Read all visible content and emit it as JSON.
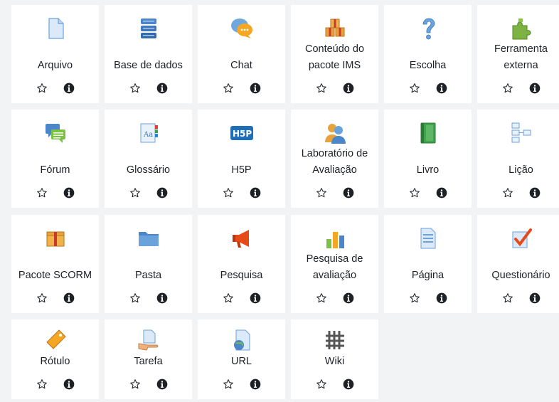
{
  "activities": [
    {
      "name": "Arquivo",
      "icon": "file-icon"
    },
    {
      "name": "Base de dados",
      "icon": "database-icon"
    },
    {
      "name": "Chat",
      "icon": "chat-bubbles-icon"
    },
    {
      "name": "Conteúdo do pacote IMS",
      "icon": "ims-package-icon"
    },
    {
      "name": "Escolha",
      "icon": "question-mark-icon"
    },
    {
      "name": "Ferramenta externa",
      "icon": "puzzle-piece-icon"
    },
    {
      "name": "Fórum",
      "icon": "forum-bubbles-icon"
    },
    {
      "name": "Glossário",
      "icon": "glossary-book-icon"
    },
    {
      "name": "H5P",
      "icon": "h5p-icon"
    },
    {
      "name": "Laboratório de Avaliação",
      "icon": "workshop-people-icon"
    },
    {
      "name": "Livro",
      "icon": "book-icon"
    },
    {
      "name": "Lição",
      "icon": "lesson-flow-icon"
    },
    {
      "name": "Pacote SCORM",
      "icon": "scorm-package-icon"
    },
    {
      "name": "Pasta",
      "icon": "folder-icon"
    },
    {
      "name": "Pesquisa",
      "icon": "megaphone-icon"
    },
    {
      "name": "Pesquisa de avaliação",
      "icon": "bar-chart-icon"
    },
    {
      "name": "Página",
      "icon": "page-icon"
    },
    {
      "name": "Questionário",
      "icon": "quiz-checkmark-icon"
    },
    {
      "name": "Rótulo",
      "icon": "label-tag-icon"
    },
    {
      "name": "Tarefa",
      "icon": "assignment-hand-icon"
    },
    {
      "name": "URL",
      "icon": "url-globe-icon"
    },
    {
      "name": "Wiki",
      "icon": "wiki-icon"
    }
  ],
  "colors": {
    "background": "#f2f3f4",
    "tile": "#ffffff",
    "text": "#1d2125",
    "action_icon": "#1d2125"
  }
}
